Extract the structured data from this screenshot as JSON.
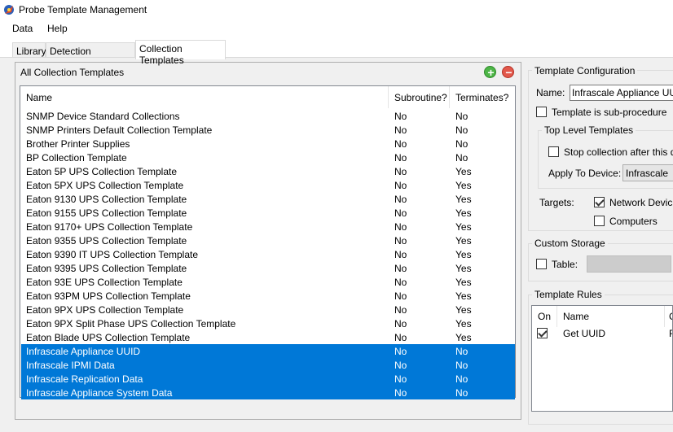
{
  "window": {
    "title": "Probe Template Management"
  },
  "menu": [
    {
      "label": "Data"
    },
    {
      "label": "Help"
    }
  ],
  "tabs": [
    {
      "label": "Library"
    },
    {
      "label": "Detection Templates"
    },
    {
      "label": "Collection Templates"
    }
  ],
  "templates_panel": {
    "title": "All Collection Templates",
    "columns": [
      "Name",
      "Subroutine?",
      "Terminates?"
    ],
    "rows": [
      {
        "name": "SNMP Device Standard Collections",
        "subroutine": "No",
        "terminates": "No"
      },
      {
        "name": "SNMP Printers Default Collection Template",
        "subroutine": "No",
        "terminates": "No"
      },
      {
        "name": "Brother Printer Supplies",
        "subroutine": "No",
        "terminates": "No"
      },
      {
        "name": "BP Collection Template",
        "subroutine": "No",
        "terminates": "No"
      },
      {
        "name": "Eaton 5P UPS Collection Template",
        "subroutine": "No",
        "terminates": "Yes"
      },
      {
        "name": "Eaton 5PX UPS Collection Template",
        "subroutine": "No",
        "terminates": "Yes"
      },
      {
        "name": "Eaton 9130 UPS Collection Template",
        "subroutine": "No",
        "terminates": "Yes"
      },
      {
        "name": "Eaton 9155 UPS Collection Template",
        "subroutine": "No",
        "terminates": "Yes"
      },
      {
        "name": "Eaton 9170+ UPS Collection Template",
        "subroutine": "No",
        "terminates": "Yes"
      },
      {
        "name": "Eaton 9355 UPS Collection Template",
        "subroutine": "No",
        "terminates": "Yes"
      },
      {
        "name": "Eaton 9390 IT UPS Collection Template",
        "subroutine": "No",
        "terminates": "Yes"
      },
      {
        "name": "Eaton 9395 UPS Collection Template",
        "subroutine": "No",
        "terminates": "Yes"
      },
      {
        "name": "Eaton 93E UPS Collection Template",
        "subroutine": "No",
        "terminates": "Yes"
      },
      {
        "name": "Eaton 93PM UPS Collection Template",
        "subroutine": "No",
        "terminates": "Yes"
      },
      {
        "name": "Eaton 9PX UPS Collection Template",
        "subroutine": "No",
        "terminates": "Yes"
      },
      {
        "name": "Eaton 9PX Split Phase UPS Collection Template",
        "subroutine": "No",
        "terminates": "Yes"
      },
      {
        "name": "Eaton Blade UPS Collection Template",
        "subroutine": "No",
        "terminates": "Yes"
      },
      {
        "name": "Infrascale Appliance UUID",
        "subroutine": "No",
        "terminates": "No",
        "selected": true
      },
      {
        "name": "Infrascale IPMI Data",
        "subroutine": "No",
        "terminates": "No",
        "selected": true
      },
      {
        "name": "Infrascale Replication Data",
        "subroutine": "No",
        "terminates": "No",
        "selected": true
      },
      {
        "name": "Infrascale Appliance System Data",
        "subroutine": "No",
        "terminates": "No",
        "selected": true
      }
    ]
  },
  "config": {
    "title": "Template Configuration",
    "name_label": "Name:",
    "name_value": "Infrascale Appliance UUID",
    "sub_procedure_label": "Template is sub-procedure",
    "sub_procedure_checked": false,
    "top_level": {
      "title": "Top Level Templates",
      "stop_label": "Stop collection after this d",
      "stop_checked": false,
      "apply_label": "Apply To Device:",
      "apply_value": "Infrascale"
    },
    "targets_label": "Targets:",
    "targets": [
      {
        "label": "Network Devic",
        "checked": true
      },
      {
        "label": "Computers",
        "checked": false
      }
    ]
  },
  "custom_storage": {
    "title": "Custom Storage",
    "table_label": "Table:",
    "table_checked": false
  },
  "rules": {
    "title": "Template Rules",
    "columns": [
      "On",
      "Name",
      "C"
    ],
    "rows": [
      {
        "on": true,
        "name": "Get UUID",
        "extra": "F"
      }
    ]
  },
  "colors": {
    "selection": "#0078d7",
    "panel_bg": "#f0f0f0",
    "add_green": "#4db546",
    "remove_red": "#e2584b"
  },
  "icons": {
    "app": "probe-app-icon",
    "add": "plus-circle-icon",
    "remove": "minus-circle-icon"
  }
}
